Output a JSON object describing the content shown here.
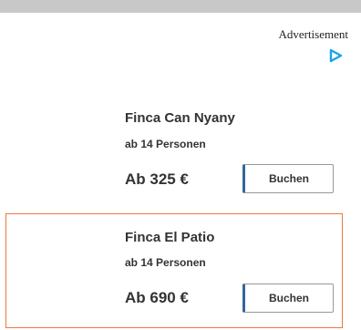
{
  "advertisement": {
    "label": "Advertisement",
    "icon": "play-triangle-icon",
    "icon_color": "#1aa3e8"
  },
  "listings": [
    {
      "name": "Finca Can Nyany",
      "capacity": "ab 14 Personen",
      "price": "Ab 325 €",
      "button_label": "Buchen"
    },
    {
      "name": "Finca El Patio",
      "capacity": "ab 14 Personen",
      "price": "Ab 690 €",
      "button_label": "Buchen",
      "highlight_color": "#e97a3a"
    }
  ]
}
